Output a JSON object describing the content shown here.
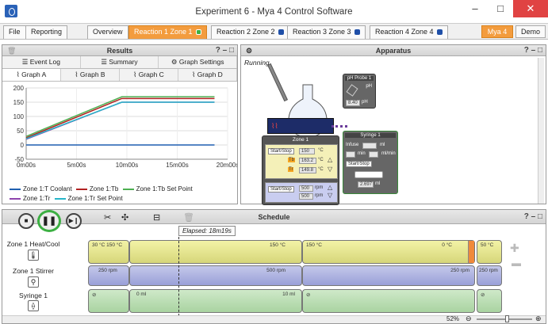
{
  "window": {
    "title": "Experiment 6 - Mya 4 Control Software",
    "minimize": "–",
    "maximize": "□",
    "close": "✕"
  },
  "menu": {
    "tabs": [
      "File",
      "Reporting",
      "Overview",
      "Reaction 1 Zone 1",
      "Reaction 2 Zone 2",
      "Reaction 3 Zone 3",
      "Reaction 4 Zone 4"
    ],
    "mya4": "Mya 4",
    "demo": "Demo"
  },
  "results": {
    "title": "Results",
    "buttons": [
      "Event Log",
      "Summary",
      "Graph Settings"
    ],
    "graph_tabs": [
      "Graph A",
      "Graph B",
      "Graph C",
      "Graph D"
    ],
    "legend": [
      "Zone 1:T Coolant",
      "Zone 1:Tb",
      "Zone 1:Tb Set Point",
      "Zone 1:Tr",
      "Zone 1:Tr Set Point"
    ]
  },
  "chart_data": {
    "type": "line",
    "xlabel": "",
    "ylabel": "",
    "x_ticks": [
      "0m00s",
      "5m00s",
      "10m00s",
      "15m00s",
      "20m00s"
    ],
    "y_ticks": [
      "-50",
      "0",
      "50",
      "100",
      "150",
      "200"
    ],
    "ylim": [
      -50,
      200
    ],
    "xlim": [
      0,
      20
    ],
    "series": [
      {
        "name": "Zone 1:T Coolant",
        "color": "#1f5fb0",
        "points": [
          [
            0,
            0
          ],
          [
            18.7,
            0
          ]
        ]
      },
      {
        "name": "Zone 1:Tb",
        "color": "#b22222",
        "points": [
          [
            0,
            25
          ],
          [
            9.5,
            163
          ],
          [
            18.7,
            163
          ]
        ]
      },
      {
        "name": "Zone 1:Tb Set Point",
        "color": "#4caf50",
        "points": [
          [
            0,
            30
          ],
          [
            9.5,
            169
          ],
          [
            18.7,
            169
          ]
        ]
      },
      {
        "name": "Zone 1:Tr",
        "color": "#8e44ad",
        "points": [
          [
            0,
            20
          ],
          [
            9.5,
            150
          ],
          [
            18.7,
            150
          ]
        ]
      },
      {
        "name": "Zone 1:Tr Set Point",
        "color": "#26b5c8",
        "points": [
          [
            0,
            22
          ],
          [
            9.5,
            150
          ],
          [
            18.7,
            150
          ]
        ]
      }
    ]
  },
  "apparatus": {
    "title": "Apparatus",
    "status": "Running",
    "probe": {
      "title": "pH Probe 1",
      "unit": "pH",
      "value": "8.40",
      "value_unit": "pH"
    },
    "zone": {
      "title": "Zone 1",
      "startstop": "Start/Stop",
      "temp_set": "150",
      "temp_unit": "°C",
      "tb_label": "Tb",
      "tb_value": "163.2",
      "tr_label": "Tr",
      "tr_value": "149.8",
      "stir_set": "500",
      "stir_unit": "rpm",
      "stir_value": "500"
    },
    "syringe": {
      "title": "Syringe 1",
      "infuse": "Infuse",
      "ml": "ml",
      "min": "min",
      "mlmin": "ml/min",
      "startstop": "Start/Stop",
      "volume": "2.697",
      "volume_unit": "ml"
    }
  },
  "schedule": {
    "title": "Schedule",
    "elapsed": "Elapsed: 18m19s",
    "zoom": "52%",
    "rows": [
      {
        "label": "Zone 1 Heat/Cool",
        "icon": "thermometer-icon"
      },
      {
        "label": "Zone 1 Stirrer",
        "icon": "stirrer-icon"
      },
      {
        "label": "Syringe 1",
        "icon": "syringe-icon"
      }
    ],
    "heat_segments": [
      "30 °C  150 °C",
      "150 °C",
      "150 °C",
      "0 °C",
      "50 °C"
    ],
    "stir_segments": [
      "250 rpm",
      "500 rpm",
      "250 rpm",
      "250 rpm"
    ],
    "syringe_segments": [
      "0 ml",
      "10 ml"
    ]
  }
}
